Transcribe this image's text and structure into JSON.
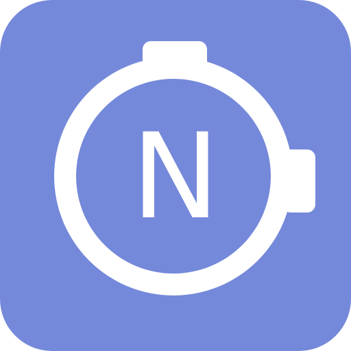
{
  "app_icon": {
    "letter": "N",
    "icon_name": "stopwatch-icon",
    "colors": {
      "background": "#7589DA",
      "foreground": "#FFFFFF"
    }
  }
}
